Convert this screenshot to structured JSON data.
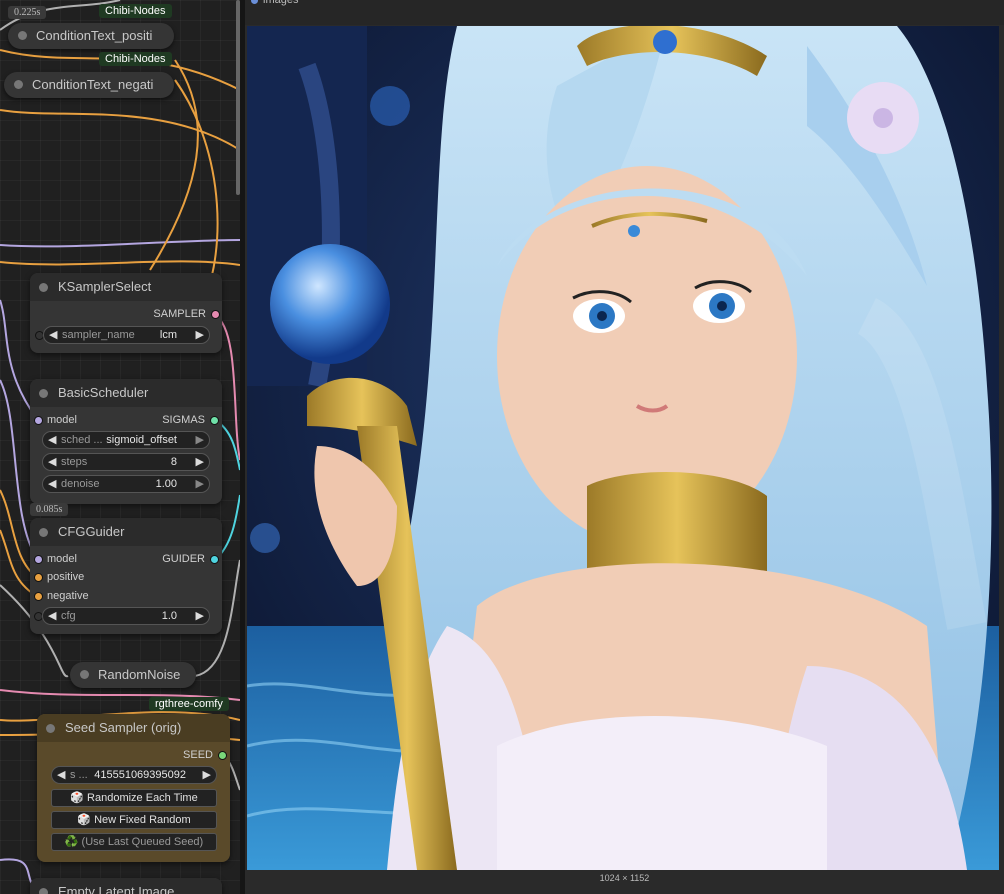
{
  "nodes": {
    "condition_pos": {
      "title": "ConditionText_positi",
      "badge": "Chibi-Nodes",
      "time": "0.225s"
    },
    "condition_neg": {
      "title": "ConditionText_negati",
      "badge": "Chibi-Nodes"
    },
    "ksampler_select": {
      "title": "KSamplerSelect",
      "output": "SAMPLER",
      "widget": {
        "name": "sampler_name",
        "value": "lcm"
      }
    },
    "basic_scheduler": {
      "title": "BasicScheduler",
      "input": "model",
      "output": "SIGMAS",
      "widgets": [
        {
          "name": "sched ...",
          "value": "sigmoid_offset"
        },
        {
          "name": "steps",
          "value": "8"
        },
        {
          "name": "denoise",
          "value": "1.00"
        }
      ],
      "time": "0.085s"
    },
    "cfg_guider": {
      "title": "CFGGuider",
      "inputs": [
        "model",
        "positive",
        "negative"
      ],
      "output": "GUIDER",
      "widget": {
        "name": "cfg",
        "value": "1.0"
      }
    },
    "random_noise": {
      "title": "RandomNoise",
      "badge": "rgthree-comfy"
    },
    "seed_sampler": {
      "title": "Seed Sampler (orig)",
      "output": "SEED",
      "widget": {
        "name": "s ...",
        "value": "415551069395092"
      },
      "buttons": [
        "🎲 Randomize Each Time",
        "🎲 New Fixed Random",
        "♻️ (Use Last Queued Seed)"
      ]
    },
    "empty_latent": {
      "title": "Empty Latent Image"
    }
  },
  "preview": {
    "caption": "images",
    "dimensions": "1024 × 1152"
  },
  "colors": {
    "canvas_bg": "#202020",
    "node_bg": "#353535",
    "seed_node_bg": "#5a4a2a",
    "badge_bg": "#1f3a22",
    "wire_orange": "#e8a040",
    "wire_lavender": "#b4a6e0",
    "wire_pink": "#e58ab0",
    "wire_cyan": "#4fd4e0",
    "wire_gray": "#b0b0b0"
  }
}
